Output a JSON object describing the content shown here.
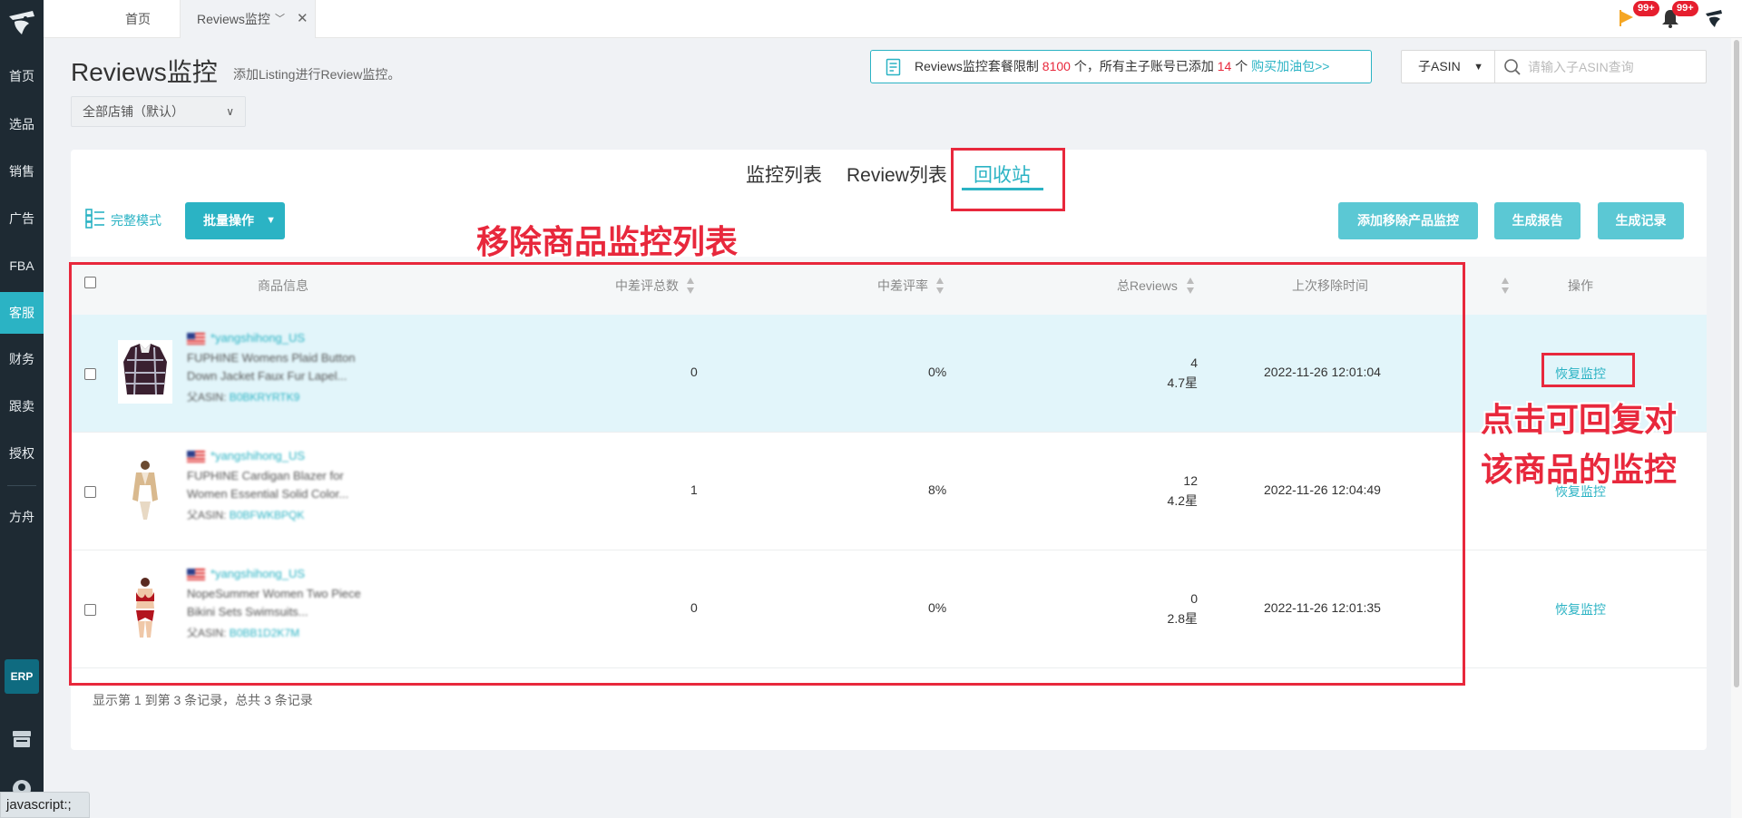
{
  "sidebar": {
    "items": [
      {
        "label": "首页"
      },
      {
        "label": "选品"
      },
      {
        "label": "销售"
      },
      {
        "label": "广告"
      },
      {
        "label": "FBA"
      },
      {
        "label": "客服"
      },
      {
        "label": "财务"
      },
      {
        "label": "跟卖"
      },
      {
        "label": "授权"
      },
      {
        "label": "方舟"
      }
    ],
    "active": "客服",
    "erp_label": "ERP"
  },
  "topbar": {
    "tabs": [
      {
        "label": "首页"
      },
      {
        "label": "Reviews监控"
      }
    ],
    "flag_badge": "99+",
    "bell_badge": "99+"
  },
  "header": {
    "title": "Reviews监控",
    "subtitle": "添加Listing进行Review监控。",
    "store_select": "全部店铺（默认）"
  },
  "notice": {
    "prefix": "Reviews监控套餐限制 ",
    "limit": "8100",
    "middle": " 个，所有主子账号已添加 ",
    "added": "14",
    "suffix": " 个 ",
    "link": "购买加油包>>"
  },
  "search": {
    "select_value": "子ASIN",
    "placeholder": "请输入子ASIN查询"
  },
  "subtabs": [
    {
      "label": "监控列表"
    },
    {
      "label": "Review列表"
    },
    {
      "label": "回收站"
    }
  ],
  "toolbar": {
    "mode_label": "完整模式",
    "batch_label": "批量操作",
    "add_removed_label": "添加移除产品监控",
    "report_label": "生成报告",
    "records_label": "生成记录"
  },
  "table": {
    "headers": {
      "product": "商品信息",
      "neg_count": "中差评总数",
      "neg_rate": "中差评率",
      "total_reviews": "总Reviews",
      "last_removed": "上次移除时间",
      "actions": "操作"
    },
    "rows": [
      {
        "shop": "*yangshihong_US",
        "title": "FUPHINE Womens Plaid Button Down Jacket Faux Fur Lapel...",
        "asin_label": "父ASIN:",
        "asin": "B0BKRYRTK9",
        "neg_count": "0",
        "neg_rate": "0%",
        "reviews": "4",
        "stars": "4.7星",
        "time": "2022-11-26 12:01:04",
        "action": "恢复监控"
      },
      {
        "shop": "*yangshihong_US",
        "title": "FUPHINE Cardigan Blazer for Women Essential Solid Color...",
        "asin_label": "父ASIN:",
        "asin": "B0BFWKBPQK",
        "neg_count": "1",
        "neg_rate": "8%",
        "reviews": "12",
        "stars": "4.2星",
        "time": "2022-11-26 12:04:49",
        "action": "恢复监控"
      },
      {
        "shop": "*yangshihong_US",
        "title": "NopeSummer Women Two Piece Bikini Sets Swimsuits...",
        "asin_label": "父ASIN:",
        "asin": "B0BB1D2K7M",
        "neg_count": "0",
        "neg_rate": "0%",
        "reviews": "0",
        "stars": "2.8星",
        "time": "2022-11-26 12:01:35",
        "action": "恢复监控"
      }
    ],
    "footer": "显示第 1 到第 3 条记录，总共 3 条记录"
  },
  "annotations": {
    "list_label": "移除商品监控列表",
    "restore_line1": "点击可回复对",
    "restore_line2": "该商品的监控"
  },
  "status_tip": "javascript:;",
  "colors": {
    "accent": "#2bb3c4",
    "annotation": "#e8283c",
    "sidebar": "#1e2a33"
  }
}
